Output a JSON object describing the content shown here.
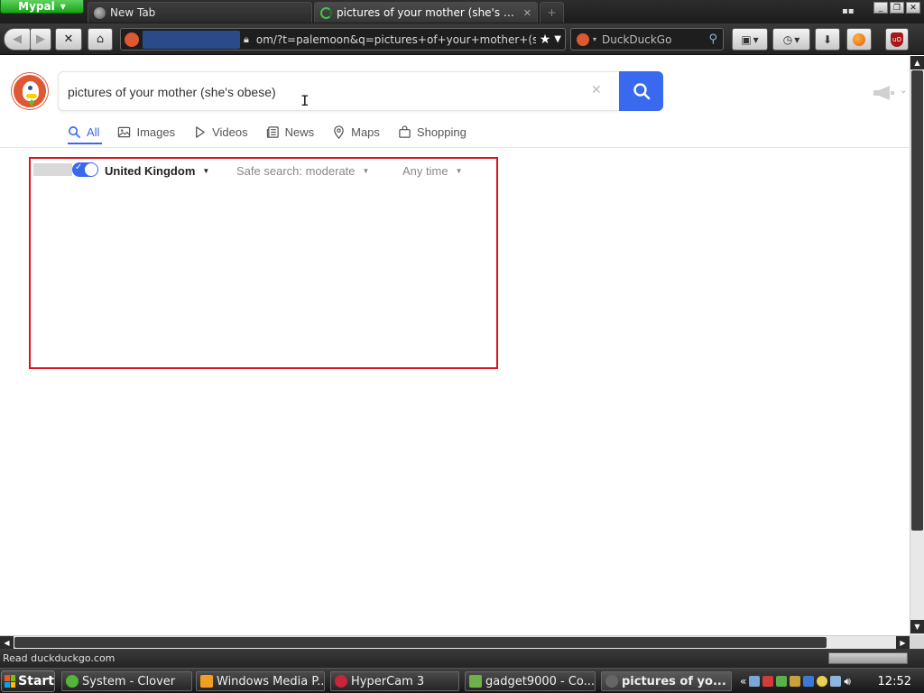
{
  "browser": {
    "app_menu_label": "Mypal",
    "tabs": [
      {
        "label": "New Tab"
      },
      {
        "label": "pictures of your mother (she's ob···"
      }
    ],
    "url": "om/?t=palemoon&q=pictures+of+your+mother+(she's+c",
    "search_engine": "DuckDuckGo",
    "status_text": "Read duckduckgo.com"
  },
  "page": {
    "search_query": "pictures of your mother (she's obese)",
    "tabs": [
      {
        "label": "All",
        "icon": "search-icon",
        "active": true
      },
      {
        "label": "Images",
        "icon": "image-icon"
      },
      {
        "label": "Videos",
        "icon": "play-icon"
      },
      {
        "label": "News",
        "icon": "newspaper-icon"
      },
      {
        "label": "Maps",
        "icon": "map-pin-icon"
      },
      {
        "label": "Shopping",
        "icon": "shopping-bag-icon"
      }
    ],
    "filters": {
      "region": "United Kingdom",
      "safe_search": "Safe search: moderate",
      "time": "Any time"
    },
    "colors": {
      "accent": "#3969ef",
      "ddg_orange": "#de5833",
      "highlight_box": "#d8151f"
    }
  },
  "taskbar": {
    "start_label": "Start",
    "tasks": [
      {
        "label": "System - Clover"
      },
      {
        "label": "Windows Media P..."
      },
      {
        "label": "HyperCam 3"
      },
      {
        "label": "gadget9000 - Co..."
      },
      {
        "label": "pictures of yo..."
      }
    ],
    "tray_chevron": "«",
    "clock": "12:52"
  }
}
